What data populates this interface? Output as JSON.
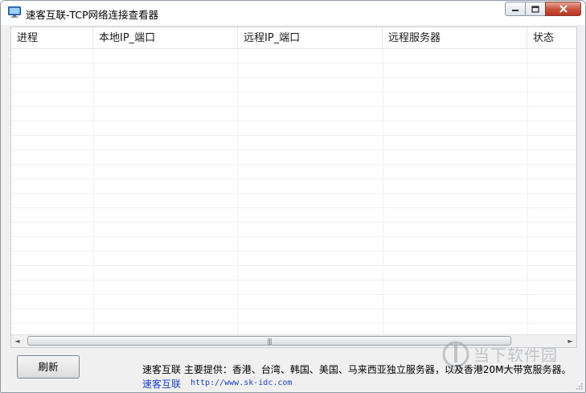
{
  "window": {
    "title": "速客互联-TCP网络连接查看器"
  },
  "controls": {
    "minimize_icon": "minimize-icon",
    "maximize_icon": "maximize-icon",
    "close_icon": "close-icon"
  },
  "table": {
    "columns": [
      "进程",
      "本地IP_端口",
      "远程IP_端口",
      "远程服务器",
      "状态"
    ],
    "rows": []
  },
  "scrollbar": {
    "left_arrow": "◄",
    "right_arrow": "►",
    "grip": "|||"
  },
  "footer": {
    "refresh_label": "刷新",
    "info_text": "速客互联  主要提供：香港、台湾、韩国、美国、马来西亚独立服务器，以及香港20M大带宽服务器。",
    "link_name": "速客互联",
    "link_url": "http://www.sk-idc.com"
  },
  "watermark": {
    "text": "当下软件园",
    "url": "WWW.DOWNXIA.COM"
  },
  "colors": {
    "close_button": "#c7503a",
    "link": "#1a3fd0",
    "window_bg": "#f0f0f0"
  }
}
